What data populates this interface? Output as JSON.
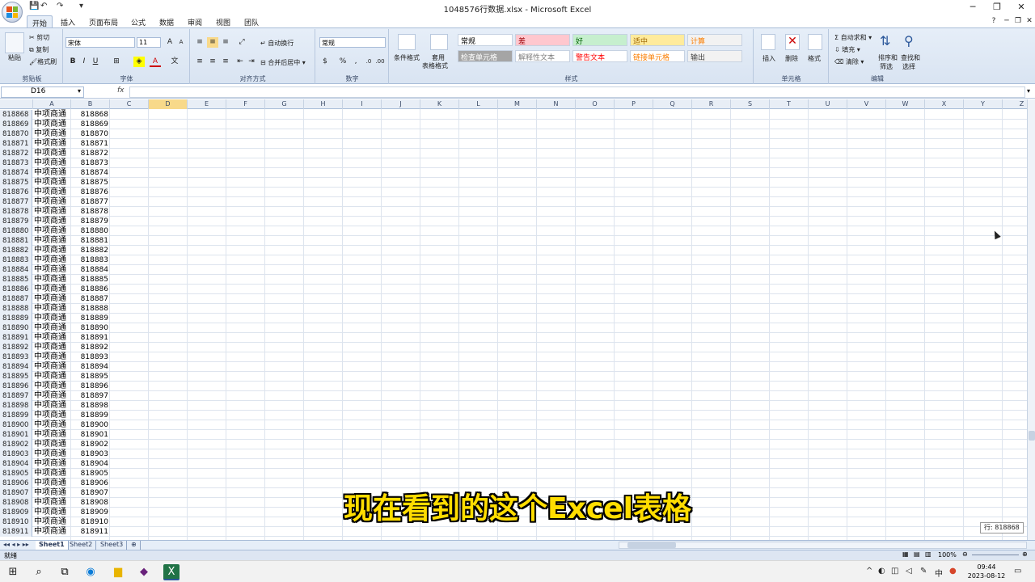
{
  "window": {
    "title": "1048576行数据.xlsx - Microsoft Excel",
    "minimize": "─",
    "restore": "❐",
    "close": "✕"
  },
  "tabs": [
    "开始",
    "插入",
    "页面布局",
    "公式",
    "数据",
    "审阅",
    "视图",
    "团队"
  ],
  "ribbon": {
    "clipboard": {
      "paste": "粘贴",
      "cut": "剪切",
      "copy": "复制",
      "format_painter": "格式刷",
      "label": "剪贴板"
    },
    "font": {
      "name": "宋体",
      "size": "11",
      "label": "字体"
    },
    "alignment": {
      "wrap": "自动换行",
      "merge": "合并后居中",
      "label": "对齐方式"
    },
    "number": {
      "format": "常规",
      "label": "数字"
    },
    "styles": {
      "conditional": "条件格式",
      "table_format_1": "套用",
      "table_format_2": "表格格式",
      "cells": [
        {
          "text": "常规",
          "bg": "#ffffff",
          "color": "#000000"
        },
        {
          "text": "差",
          "bg": "#ffc7ce",
          "color": "#9c0006"
        },
        {
          "text": "好",
          "bg": "#c6efce",
          "color": "#006100"
        },
        {
          "text": "适中",
          "bg": "#ffeb9c",
          "color": "#9c6500"
        },
        {
          "text": "计算",
          "bg": "#f2f2f2",
          "color": "#fa7d00"
        },
        {
          "text": "检查单元格",
          "bg": "#a5a5a5",
          "color": "#ffffff"
        },
        {
          "text": "解释性文本",
          "bg": "#ffffff",
          "color": "#7f7f7f"
        },
        {
          "text": "警告文本",
          "bg": "#ffffff",
          "color": "#ff0000"
        },
        {
          "text": "链接单元格",
          "bg": "#ffffff",
          "color": "#fa7d00"
        },
        {
          "text": "输出",
          "bg": "#f2f2f2",
          "color": "#3f3f3f"
        }
      ],
      "label": "样式"
    },
    "cells": {
      "insert": "插入",
      "delete": "删除",
      "format": "格式",
      "label": "单元格"
    },
    "editing": {
      "autosum": "自动求和",
      "fill": "填充",
      "clear": "清除",
      "sort_1": "排序和",
      "sort_2": "筛选",
      "find_1": "查找和",
      "find_2": "选择",
      "label": "编辑"
    }
  },
  "formula_bar": {
    "name_box": "D16",
    "fx": "fx",
    "value": ""
  },
  "columns": [
    "A",
    "B",
    "C",
    "D",
    "E",
    "F",
    "G",
    "H",
    "I",
    "J",
    "K",
    "L",
    "M",
    "N",
    "O",
    "P",
    "Q",
    "R",
    "S",
    "T",
    "U",
    "V",
    "W",
    "X",
    "Y",
    "Z"
  ],
  "selected_column": "D",
  "rows": [
    {
      "num": "818868",
      "a": "中项商通",
      "b": "818868"
    },
    {
      "num": "818869",
      "a": "中项商通",
      "b": "818869"
    },
    {
      "num": "818870",
      "a": "中项商通",
      "b": "818870"
    },
    {
      "num": "818871",
      "a": "中项商通",
      "b": "818871"
    },
    {
      "num": "818872",
      "a": "中项商通",
      "b": "818872"
    },
    {
      "num": "818873",
      "a": "中项商通",
      "b": "818873"
    },
    {
      "num": "818874",
      "a": "中项商通",
      "b": "818874"
    },
    {
      "num": "818875",
      "a": "中项商通",
      "b": "818875"
    },
    {
      "num": "818876",
      "a": "中项商通",
      "b": "818876"
    },
    {
      "num": "818877",
      "a": "中项商通",
      "b": "818877"
    },
    {
      "num": "818878",
      "a": "中项商通",
      "b": "818878"
    },
    {
      "num": "818879",
      "a": "中项商通",
      "b": "818879"
    },
    {
      "num": "818880",
      "a": "中项商通",
      "b": "818880"
    },
    {
      "num": "818881",
      "a": "中项商通",
      "b": "818881"
    },
    {
      "num": "818882",
      "a": "中项商通",
      "b": "818882"
    },
    {
      "num": "818883",
      "a": "中项商通",
      "b": "818883"
    },
    {
      "num": "818884",
      "a": "中项商通",
      "b": "818884"
    },
    {
      "num": "818885",
      "a": "中项商通",
      "b": "818885"
    },
    {
      "num": "818886",
      "a": "中项商通",
      "b": "818886"
    },
    {
      "num": "818887",
      "a": "中项商通",
      "b": "818887"
    },
    {
      "num": "818888",
      "a": "中项商通",
      "b": "818888"
    },
    {
      "num": "818889",
      "a": "中项商通",
      "b": "818889"
    },
    {
      "num": "818890",
      "a": "中项商通",
      "b": "818890"
    },
    {
      "num": "818891",
      "a": "中项商通",
      "b": "818891"
    },
    {
      "num": "818892",
      "a": "中项商通",
      "b": "818892"
    },
    {
      "num": "818893",
      "a": "中项商通",
      "b": "818893"
    },
    {
      "num": "818894",
      "a": "中项商通",
      "b": "818894"
    },
    {
      "num": "818895",
      "a": "中项商通",
      "b": "818895"
    },
    {
      "num": "818896",
      "a": "中项商通",
      "b": "818896"
    },
    {
      "num": "818897",
      "a": "中项商通",
      "b": "818897"
    },
    {
      "num": "818898",
      "a": "中项商通",
      "b": "818898"
    },
    {
      "num": "818899",
      "a": "中项商通",
      "b": "818899"
    },
    {
      "num": "818900",
      "a": "中项商通",
      "b": "818900"
    },
    {
      "num": "818901",
      "a": "中项商通",
      "b": "818901"
    },
    {
      "num": "818902",
      "a": "中项商通",
      "b": "818902"
    },
    {
      "num": "818903",
      "a": "中项商通",
      "b": "818903"
    },
    {
      "num": "818904",
      "a": "中项商通",
      "b": "818904"
    },
    {
      "num": "818905",
      "a": "中项商通",
      "b": "818905"
    },
    {
      "num": "818906",
      "a": "中项商通",
      "b": "818906"
    },
    {
      "num": "818907",
      "a": "中项商通",
      "b": "818907"
    },
    {
      "num": "818908",
      "a": "中项商通",
      "b": "818908"
    },
    {
      "num": "818909",
      "a": "中项商通",
      "b": "818909"
    },
    {
      "num": "818910",
      "a": "中项商通",
      "b": "818910"
    },
    {
      "num": "818911",
      "a": "中项商通",
      "b": "818911"
    }
  ],
  "sheets": [
    "Sheet1",
    "Sheet2",
    "Sheet3"
  ],
  "row_tip": "行: 818868",
  "status": {
    "ready": "就绪",
    "zoom": "100%"
  },
  "subtitle": "现在看到的这个Excel表格",
  "taskbar": {
    "time": "09:44",
    "date": "2023-08-12",
    "ime": "中"
  },
  "colors": {
    "accent": "#2b579a",
    "excel_green": "#217346",
    "subtitle": "#ffdd00"
  }
}
